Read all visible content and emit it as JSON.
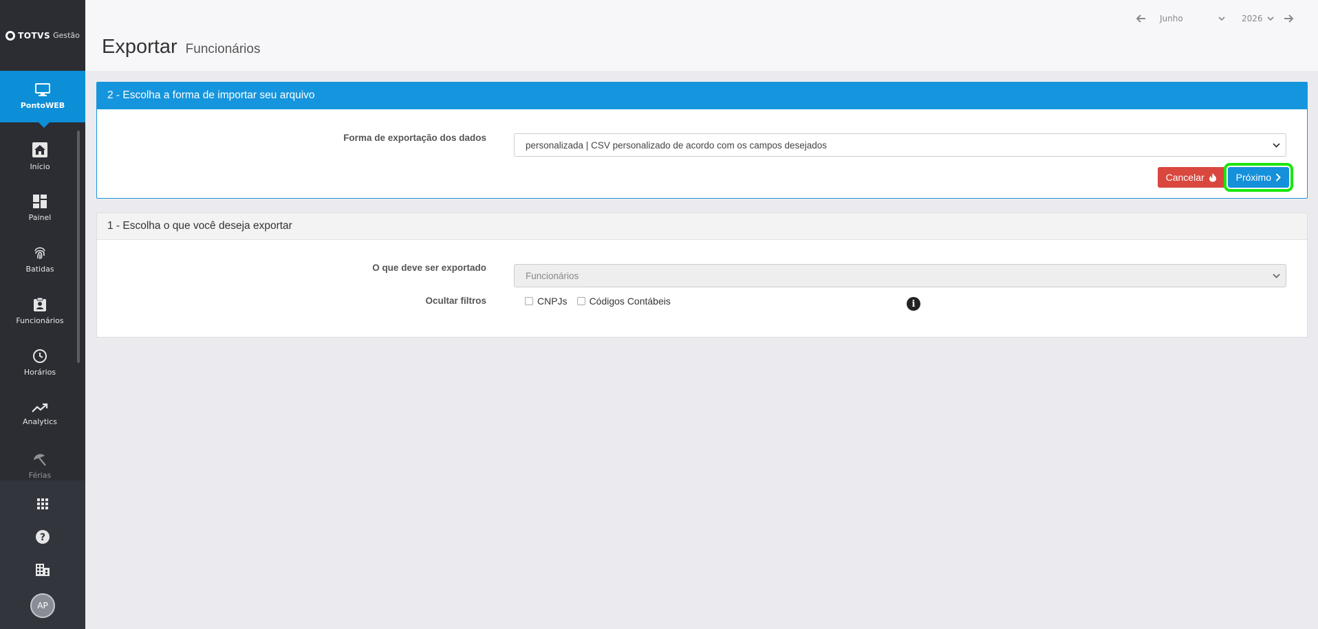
{
  "brand": {
    "name": "TOTVS",
    "suffix": "Gestão"
  },
  "product": {
    "label": "PontoWEB",
    "icon": "monitor-icon"
  },
  "sidebar": {
    "items": [
      {
        "label": "Início",
        "icon": "home-icon"
      },
      {
        "label": "Painel",
        "icon": "dashboard-icon"
      },
      {
        "label": "Batidas",
        "icon": "fingerprint-icon"
      },
      {
        "label": "Funcionários",
        "icon": "badge-icon"
      },
      {
        "label": "Horários",
        "icon": "clock-icon"
      },
      {
        "label": "Analytics",
        "icon": "trending-icon"
      },
      {
        "label": "Férias",
        "icon": "umbrella-icon"
      }
    ],
    "tools": [
      "apps-grid-icon",
      "help-icon",
      "building-icon"
    ],
    "avatar_initials": "AP"
  },
  "header": {
    "title": "Exportar",
    "subtitle": "Funcionários",
    "month": "Junho",
    "year": "2026"
  },
  "panel2": {
    "title": "2 - Escolha a forma de importar seu arquivo",
    "field_label": "Forma de exportação dos dados",
    "field_value": "personalizada | CSV personalizado de acordo com os campos desejados",
    "cancel_label": "Cancelar",
    "next_label": "Próximo"
  },
  "panel1": {
    "title": "1 - Escolha o que você deseja exportar",
    "field_label": "O que deve ser exportado",
    "field_value": "Funcionários",
    "hide_filters_label": "Ocultar filtros",
    "checkboxes": [
      {
        "label": "CNPJs",
        "checked": false
      },
      {
        "label": "Códigos Contábeis",
        "checked": false
      }
    ]
  },
  "colors": {
    "sidebar": "#2b2d33",
    "accent": "#1595dd",
    "danger": "#d9473f",
    "highlight": "#19e50d"
  }
}
